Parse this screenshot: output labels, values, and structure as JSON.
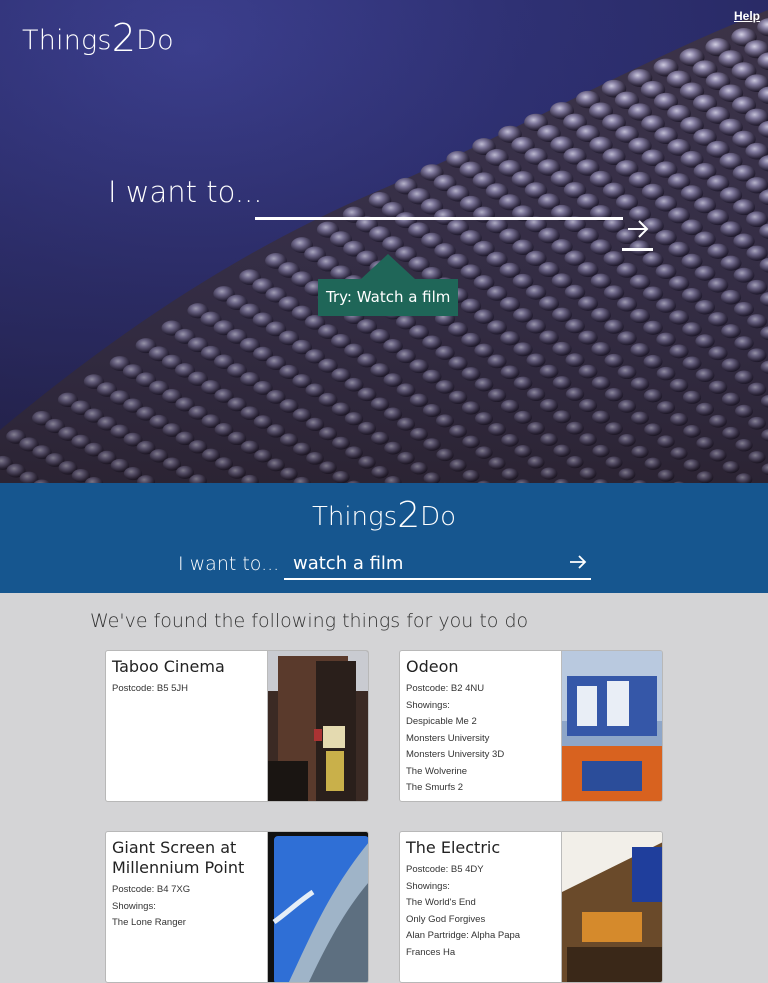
{
  "header": {
    "logo_left": "Things",
    "logo_num": "2",
    "logo_right": "Do",
    "help_label": "Help"
  },
  "hero": {
    "prompt": "I want to...",
    "input_value": "",
    "go_icon": "arrow-right-icon",
    "try_label": "Try:",
    "try_suggestion": "Watch a film"
  },
  "bar": {
    "logo_left": "Things",
    "logo_num": "2",
    "logo_right": "Do",
    "prompt": "I want to...",
    "input_value": "watch a film",
    "go_icon": "arrow-right-icon"
  },
  "results": {
    "heading": "We've found the following things for you to do",
    "cards": [
      {
        "name": "Taboo Cinema",
        "postcode": "Postcode: B5 5JH",
        "lines": []
      },
      {
        "name": "Odeon",
        "postcode": "Postcode: B2 4NU",
        "lines": [
          "Showings:",
          "Despicable Me 2",
          "Monsters University",
          "Monsters University 3D",
          "The Wolverine",
          "The Smurfs 2"
        ]
      },
      {
        "name": "Giant Screen at Millennium Point",
        "postcode": "Postcode: B4 7XG",
        "lines": [
          "Showings:",
          "The Lone Ranger"
        ]
      },
      {
        "name": "The Electric",
        "postcode": "Postcode: B5 4DY",
        "lines": [
          "Showings:",
          "The World's End",
          "Only God Forgives",
          "Alan Partridge: Alpha Papa",
          "Frances Ha"
        ]
      }
    ]
  },
  "colors": {
    "hero_bg": "#2f3174",
    "bar_bg": "#16568f",
    "try_bg": "#1f6658",
    "page_bg": "#d4d4d6"
  }
}
